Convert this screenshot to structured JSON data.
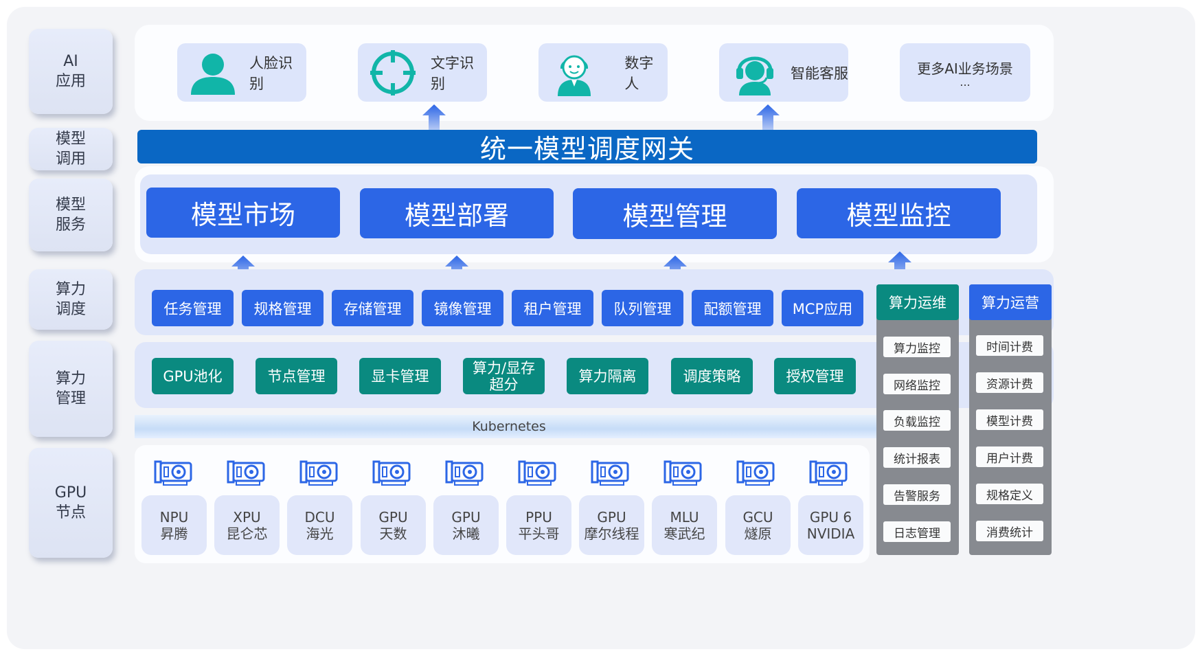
{
  "layers": [
    {
      "line1": "AI",
      "line2": "应用"
    },
    {
      "line1": "模型",
      "line2": "调用"
    },
    {
      "line1": "模型",
      "line2": "服务"
    },
    {
      "line1": "算力",
      "line2": "调度"
    },
    {
      "line1": "算力",
      "line2": "管理"
    },
    {
      "line1": "GPU",
      "line2": "节点"
    }
  ],
  "ai_apps": [
    {
      "label": "人脸识别",
      "icon": "person-icon"
    },
    {
      "label": "文字识别",
      "icon": "crosshair-icon"
    },
    {
      "label": "数字人",
      "icon": "avatar-icon"
    },
    {
      "label": "智能客服",
      "icon": "headset-icon"
    },
    {
      "label": "更多AI业务场景",
      "sub": "..."
    }
  ],
  "gateway": "统一模型调度网关",
  "model_services": [
    "模型市场",
    "模型部署",
    "模型管理",
    "模型监控"
  ],
  "scheduling": [
    "任务管理",
    "规格管理",
    "存储管理",
    "镜像管理",
    "租户管理",
    "队列管理",
    "配额管理",
    "MCP应用"
  ],
  "management": [
    {
      "line1": "GPU池化"
    },
    {
      "line1": "节点管理"
    },
    {
      "line1": "显卡管理"
    },
    {
      "line1": "算力/显存",
      "line2": "超分"
    },
    {
      "line1": "算力隔离"
    },
    {
      "line1": "调度策略"
    },
    {
      "line1": "授权管理"
    }
  ],
  "kubernetes": "Kubernetes",
  "gpu_nodes": [
    {
      "line1": "NPU",
      "line2": "昇腾"
    },
    {
      "line1": "XPU",
      "line2": "昆仑芯"
    },
    {
      "line1": "DCU",
      "line2": "海光"
    },
    {
      "line1": "GPU",
      "line2": "天数"
    },
    {
      "line1": "GPU",
      "line2": "沐曦"
    },
    {
      "line1": "PPU",
      "line2": "平头哥"
    },
    {
      "line1": "GPU",
      "line2": "摩尔线程"
    },
    {
      "line1": "MLU",
      "line2": "寒武纪"
    },
    {
      "line1": "GCU",
      "line2": "燧原"
    },
    {
      "line1": "GPU 6",
      "line2": "NVIDIA"
    }
  ],
  "ops": {
    "title": "算力运维",
    "color": "#0a8a80",
    "items": [
      "算力监控",
      "网络监控",
      "负载监控",
      "统计报表",
      "告警服务",
      "日志管理"
    ]
  },
  "operations": {
    "title": "算力运营",
    "color": "#2c66e6",
    "items": [
      "时间计费",
      "资源计费",
      "模型计费",
      "用户计费",
      "规格定义",
      "消费统计"
    ]
  },
  "colors": {
    "gateway": "#0a67c4",
    "service_blue": "#2c66e6",
    "mgmt_teal": "#0a8a80",
    "icon_teal": "#11b5a8"
  }
}
